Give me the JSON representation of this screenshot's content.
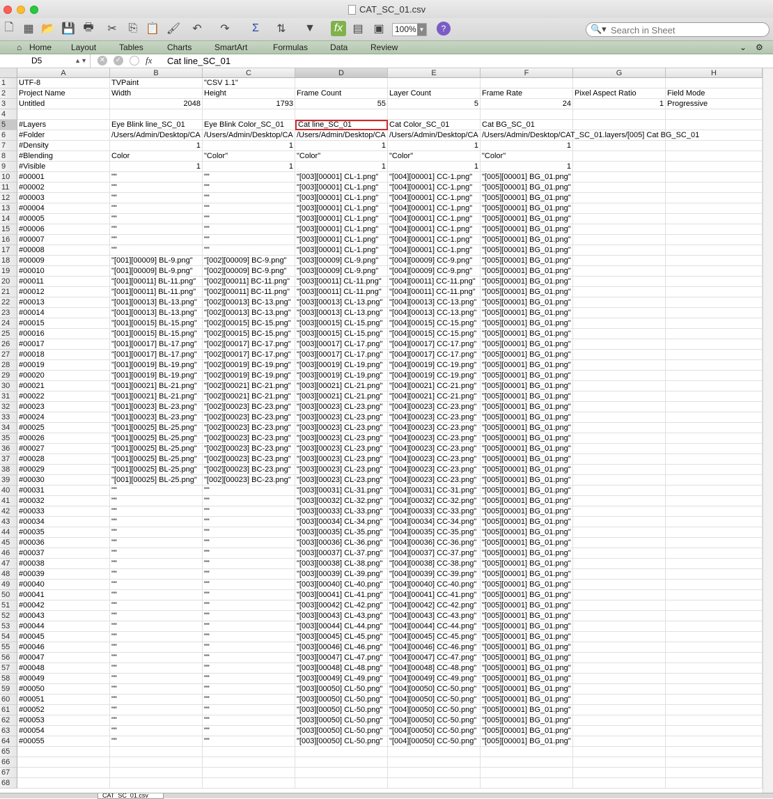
{
  "window": {
    "title": "CAT_SC_01.csv"
  },
  "toolbar": {
    "zoom": "100%",
    "search_placeholder": "Search in Sheet"
  },
  "ribbon": {
    "tabs": [
      "Home",
      "Layout",
      "Tables",
      "Charts",
      "SmartArt",
      "Formulas",
      "Data",
      "Review"
    ]
  },
  "formula_bar": {
    "cell_ref": "D5",
    "fx": "fx",
    "content": "Cat line_SC_01"
  },
  "sheet": {
    "columns": [
      "A",
      "B",
      "C",
      "D",
      "E",
      "F",
      "G",
      "H"
    ],
    "rows": [
      [
        "UTF-8",
        "TVPaint",
        "\"CSV 1.1\"",
        "",
        "",
        "",
        "",
        ""
      ],
      [
        "Project Name",
        "Width",
        "Height",
        "Frame Count",
        "Layer Count",
        "Frame Rate",
        "Pixel Aspect Ratio",
        "Field Mode"
      ],
      [
        "Untitled",
        "2048",
        "1793",
        "55",
        "5",
        "24",
        "1",
        "Progressive"
      ],
      [
        "",
        "",
        "",
        "",
        "",
        "",
        "",
        ""
      ],
      [
        "#Layers",
        "Eye Blink line_SC_01",
        "Eye Blink Color_SC_01",
        "Cat line_SC_01",
        "Cat Color_SC_01",
        "Cat BG_SC_01",
        "",
        ""
      ],
      [
        "#Folder",
        "/Users/Admin/Desktop/CA",
        "/Users/Admin/Desktop/CA",
        "/Users/Admin/Desktop/CA",
        "/Users/Admin/Desktop/CA",
        "/Users/Admin/Desktop/CAT_SC_01.layers/[005] Cat BG_SC_01",
        "",
        ""
      ],
      [
        "#Density",
        "1",
        "1",
        "1",
        "1",
        "1",
        "",
        ""
      ],
      [
        "#Blending",
        "Color",
        "\"Color\"",
        "\"Color\"",
        "\"Color\"",
        "\"Color\"",
        "",
        ""
      ],
      [
        "#Visible",
        "1",
        "1",
        "1",
        "1",
        "1",
        "",
        ""
      ],
      [
        "#00001",
        "\"\"",
        "\"\"",
        "\"[003][00001] CL-1.png\"",
        "\"[004][00001] CC-1.png\"",
        "\"[005][00001] BG_01.png\"",
        "",
        ""
      ],
      [
        "#00002",
        "\"\"",
        "\"\"",
        "\"[003][00001] CL-1.png\"",
        "\"[004][00001] CC-1.png\"",
        "\"[005][00001] BG_01.png\"",
        "",
        ""
      ],
      [
        "#00003",
        "\"\"",
        "\"\"",
        "\"[003][00001] CL-1.png\"",
        "\"[004][00001] CC-1.png\"",
        "\"[005][00001] BG_01.png\"",
        "",
        ""
      ],
      [
        "#00004",
        "\"\"",
        "\"\"",
        "\"[003][00001] CL-1.png\"",
        "\"[004][00001] CC-1.png\"",
        "\"[005][00001] BG_01.png\"",
        "",
        ""
      ],
      [
        "#00005",
        "\"\"",
        "\"\"",
        "\"[003][00001] CL-1.png\"",
        "\"[004][00001] CC-1.png\"",
        "\"[005][00001] BG_01.png\"",
        "",
        ""
      ],
      [
        "#00006",
        "\"\"",
        "\"\"",
        "\"[003][00001] CL-1.png\"",
        "\"[004][00001] CC-1.png\"",
        "\"[005][00001] BG_01.png\"",
        "",
        ""
      ],
      [
        "#00007",
        "\"\"",
        "\"\"",
        "\"[003][00001] CL-1.png\"",
        "\"[004][00001] CC-1.png\"",
        "\"[005][00001] BG_01.png\"",
        "",
        ""
      ],
      [
        "#00008",
        "\"\"",
        "\"\"",
        "\"[003][00001] CL-1.png\"",
        "\"[004][00001] CC-1.png\"",
        "\"[005][00001] BG_01.png\"",
        "",
        ""
      ],
      [
        "#00009",
        "\"[001][00009] BL-9.png\"",
        "\"[002][00009] BC-9.png\"",
        "\"[003][00009] CL-9.png\"",
        "\"[004][00009] CC-9.png\"",
        "\"[005][00001] BG_01.png\"",
        "",
        ""
      ],
      [
        "#00010",
        "\"[001][00009] BL-9.png\"",
        "\"[002][00009] BC-9.png\"",
        "\"[003][00009] CL-9.png\"",
        "\"[004][00009] CC-9.png\"",
        "\"[005][00001] BG_01.png\"",
        "",
        ""
      ],
      [
        "#00011",
        "\"[001][00011] BL-11.png\"",
        "\"[002][00011] BC-11.png\"",
        "\"[003][00011] CL-11.png\"",
        "\"[004][00011] CC-11.png\"",
        "\"[005][00001] BG_01.png\"",
        "",
        ""
      ],
      [
        "#00012",
        "\"[001][00011] BL-11.png\"",
        "\"[002][00011] BC-11.png\"",
        "\"[003][00011] CL-11.png\"",
        "\"[004][00011] CC-11.png\"",
        "\"[005][00001] BG_01.png\"",
        "",
        ""
      ],
      [
        "#00013",
        "\"[001][00013] BL-13.png\"",
        "\"[002][00013] BC-13.png\"",
        "\"[003][00013] CL-13.png\"",
        "\"[004][00013] CC-13.png\"",
        "\"[005][00001] BG_01.png\"",
        "",
        ""
      ],
      [
        "#00014",
        "\"[001][00013] BL-13.png\"",
        "\"[002][00013] BC-13.png\"",
        "\"[003][00013] CL-13.png\"",
        "\"[004][00013] CC-13.png\"",
        "\"[005][00001] BG_01.png\"",
        "",
        ""
      ],
      [
        "#00015",
        "\"[001][00015] BL-15.png\"",
        "\"[002][00015] BC-15.png\"",
        "\"[003][00015] CL-15.png\"",
        "\"[004][00015] CC-15.png\"",
        "\"[005][00001] BG_01.png\"",
        "",
        ""
      ],
      [
        "#00016",
        "\"[001][00015] BL-15.png\"",
        "\"[002][00015] BC-15.png\"",
        "\"[003][00015] CL-15.png\"",
        "\"[004][00015] CC-15.png\"",
        "\"[005][00001] BG_01.png\"",
        "",
        ""
      ],
      [
        "#00017",
        "\"[001][00017] BL-17.png\"",
        "\"[002][00017] BC-17.png\"",
        "\"[003][00017] CL-17.png\"",
        "\"[004][00017] CC-17.png\"",
        "\"[005][00001] BG_01.png\"",
        "",
        ""
      ],
      [
        "#00018",
        "\"[001][00017] BL-17.png\"",
        "\"[002][00017] BC-17.png\"",
        "\"[003][00017] CL-17.png\"",
        "\"[004][00017] CC-17.png\"",
        "\"[005][00001] BG_01.png\"",
        "",
        ""
      ],
      [
        "#00019",
        "\"[001][00019] BL-19.png\"",
        "\"[002][00019] BC-19.png\"",
        "\"[003][00019] CL-19.png\"",
        "\"[004][00019] CC-19.png\"",
        "\"[005][00001] BG_01.png\"",
        "",
        ""
      ],
      [
        "#00020",
        "\"[001][00019] BL-19.png\"",
        "\"[002][00019] BC-19.png\"",
        "\"[003][00019] CL-19.png\"",
        "\"[004][00019] CC-19.png\"",
        "\"[005][00001] BG_01.png\"",
        "",
        ""
      ],
      [
        "#00021",
        "\"[001][00021] BL-21.png\"",
        "\"[002][00021] BC-21.png\"",
        "\"[003][00021] CL-21.png\"",
        "\"[004][00021] CC-21.png\"",
        "\"[005][00001] BG_01.png\"",
        "",
        ""
      ],
      [
        "#00022",
        "\"[001][00021] BL-21.png\"",
        "\"[002][00021] BC-21.png\"",
        "\"[003][00021] CL-21.png\"",
        "\"[004][00021] CC-21.png\"",
        "\"[005][00001] BG_01.png\"",
        "",
        ""
      ],
      [
        "#00023",
        "\"[001][00023] BL-23.png\"",
        "\"[002][00023] BC-23.png\"",
        "\"[003][00023] CL-23.png\"",
        "\"[004][00023] CC-23.png\"",
        "\"[005][00001] BG_01.png\"",
        "",
        ""
      ],
      [
        "#00024",
        "\"[001][00023] BL-23.png\"",
        "\"[002][00023] BC-23.png\"",
        "\"[003][00023] CL-23.png\"",
        "\"[004][00023] CC-23.png\"",
        "\"[005][00001] BG_01.png\"",
        "",
        ""
      ],
      [
        "#00025",
        "\"[001][00025] BL-25.png\"",
        "\"[002][00023] BC-23.png\"",
        "\"[003][00023] CL-23.png\"",
        "\"[004][00023] CC-23.png\"",
        "\"[005][00001] BG_01.png\"",
        "",
        ""
      ],
      [
        "#00026",
        "\"[001][00025] BL-25.png\"",
        "\"[002][00023] BC-23.png\"",
        "\"[003][00023] CL-23.png\"",
        "\"[004][00023] CC-23.png\"",
        "\"[005][00001] BG_01.png\"",
        "",
        ""
      ],
      [
        "#00027",
        "\"[001][00025] BL-25.png\"",
        "\"[002][00023] BC-23.png\"",
        "\"[003][00023] CL-23.png\"",
        "\"[004][00023] CC-23.png\"",
        "\"[005][00001] BG_01.png\"",
        "",
        ""
      ],
      [
        "#00028",
        "\"[001][00025] BL-25.png\"",
        "\"[002][00023] BC-23.png\"",
        "\"[003][00023] CL-23.png\"",
        "\"[004][00023] CC-23.png\"",
        "\"[005][00001] BG_01.png\"",
        "",
        ""
      ],
      [
        "#00029",
        "\"[001][00025] BL-25.png\"",
        "\"[002][00023] BC-23.png\"",
        "\"[003][00023] CL-23.png\"",
        "\"[004][00023] CC-23.png\"",
        "\"[005][00001] BG_01.png\"",
        "",
        ""
      ],
      [
        "#00030",
        "\"[001][00025] BL-25.png\"",
        "\"[002][00023] BC-23.png\"",
        "\"[003][00023] CL-23.png\"",
        "\"[004][00023] CC-23.png\"",
        "\"[005][00001] BG_01.png\"",
        "",
        ""
      ],
      [
        "#00031",
        "\"\"",
        "\"\"",
        "\"[003][00031] CL-31.png\"",
        "\"[004][00031] CC-31.png\"",
        "\"[005][00001] BG_01.png\"",
        "",
        ""
      ],
      [
        "#00032",
        "\"\"",
        "\"\"",
        "\"[003][00032] CL-32.png\"",
        "\"[004][00032] CC-32.png\"",
        "\"[005][00001] BG_01.png\"",
        "",
        ""
      ],
      [
        "#00033",
        "\"\"",
        "\"\"",
        "\"[003][00033] CL-33.png\"",
        "\"[004][00033] CC-33.png\"",
        "\"[005][00001] BG_01.png\"",
        "",
        ""
      ],
      [
        "#00034",
        "\"\"",
        "\"\"",
        "\"[003][00034] CL-34.png\"",
        "\"[004][00034] CC-34.png\"",
        "\"[005][00001] BG_01.png\"",
        "",
        ""
      ],
      [
        "#00035",
        "\"\"",
        "\"\"",
        "\"[003][00035] CL-35.png\"",
        "\"[004][00035] CC-35.png\"",
        "\"[005][00001] BG_01.png\"",
        "",
        ""
      ],
      [
        "#00036",
        "\"\"",
        "\"\"",
        "\"[003][00036] CL-36.png\"",
        "\"[004][00036] CC-36.png\"",
        "\"[005][00001] BG_01.png\"",
        "",
        ""
      ],
      [
        "#00037",
        "\"\"",
        "\"\"",
        "\"[003][00037] CL-37.png\"",
        "\"[004][00037] CC-37.png\"",
        "\"[005][00001] BG_01.png\"",
        "",
        ""
      ],
      [
        "#00038",
        "\"\"",
        "\"\"",
        "\"[003][00038] CL-38.png\"",
        "\"[004][00038] CC-38.png\"",
        "\"[005][00001] BG_01.png\"",
        "",
        ""
      ],
      [
        "#00039",
        "\"\"",
        "\"\"",
        "\"[003][00039] CL-39.png\"",
        "\"[004][00039] CC-39.png\"",
        "\"[005][00001] BG_01.png\"",
        "",
        ""
      ],
      [
        "#00040",
        "\"\"",
        "\"\"",
        "\"[003][00040] CL-40.png\"",
        "\"[004][00040] CC-40.png\"",
        "\"[005][00001] BG_01.png\"",
        "",
        ""
      ],
      [
        "#00041",
        "\"\"",
        "\"\"",
        "\"[003][00041] CL-41.png\"",
        "\"[004][00041] CC-41.png\"",
        "\"[005][00001] BG_01.png\"",
        "",
        ""
      ],
      [
        "#00042",
        "\"\"",
        "\"\"",
        "\"[003][00042] CL-42.png\"",
        "\"[004][00042] CC-42.png\"",
        "\"[005][00001] BG_01.png\"",
        "",
        ""
      ],
      [
        "#00043",
        "\"\"",
        "\"\"",
        "\"[003][00043] CL-43.png\"",
        "\"[004][00043] CC-43.png\"",
        "\"[005][00001] BG_01.png\"",
        "",
        ""
      ],
      [
        "#00044",
        "\"\"",
        "\"\"",
        "\"[003][00044] CL-44.png\"",
        "\"[004][00044] CC-44.png\"",
        "\"[005][00001] BG_01.png\"",
        "",
        ""
      ],
      [
        "#00045",
        "\"\"",
        "\"\"",
        "\"[003][00045] CL-45.png\"",
        "\"[004][00045] CC-45.png\"",
        "\"[005][00001] BG_01.png\"",
        "",
        ""
      ],
      [
        "#00046",
        "\"\"",
        "\"\"",
        "\"[003][00046] CL-46.png\"",
        "\"[004][00046] CC-46.png\"",
        "\"[005][00001] BG_01.png\"",
        "",
        ""
      ],
      [
        "#00047",
        "\"\"",
        "\"\"",
        "\"[003][00047] CL-47.png\"",
        "\"[004][00047] CC-47.png\"",
        "\"[005][00001] BG_01.png\"",
        "",
        ""
      ],
      [
        "#00048",
        "\"\"",
        "\"\"",
        "\"[003][00048] CL-48.png\"",
        "\"[004][00048] CC-48.png\"",
        "\"[005][00001] BG_01.png\"",
        "",
        ""
      ],
      [
        "#00049",
        "\"\"",
        "\"\"",
        "\"[003][00049] CL-49.png\"",
        "\"[004][00049] CC-49.png\"",
        "\"[005][00001] BG_01.png\"",
        "",
        ""
      ],
      [
        "#00050",
        "\"\"",
        "\"\"",
        "\"[003][00050] CL-50.png\"",
        "\"[004][00050] CC-50.png\"",
        "\"[005][00001] BG_01.png\"",
        "",
        ""
      ],
      [
        "#00051",
        "\"\"",
        "\"\"",
        "\"[003][00050] CL-50.png\"",
        "\"[004][00050] CC-50.png\"",
        "\"[005][00001] BG_01.png\"",
        "",
        ""
      ],
      [
        "#00052",
        "\"\"",
        "\"\"",
        "\"[003][00050] CL-50.png\"",
        "\"[004][00050] CC-50.png\"",
        "\"[005][00001] BG_01.png\"",
        "",
        ""
      ],
      [
        "#00053",
        "\"\"",
        "\"\"",
        "\"[003][00050] CL-50.png\"",
        "\"[004][00050] CC-50.png\"",
        "\"[005][00001] BG_01.png\"",
        "",
        ""
      ],
      [
        "#00054",
        "\"\"",
        "\"\"",
        "\"[003][00050] CL-50.png\"",
        "\"[004][00050] CC-50.png\"",
        "\"[005][00001] BG_01.png\"",
        "",
        ""
      ],
      [
        "#00055",
        "\"\"",
        "\"\"",
        "\"[003][00050] CL-50.png\"",
        "\"[004][00050] CC-50.png\"",
        "\"[005][00001] BG_01.png\"",
        "",
        ""
      ],
      [
        "",
        "",
        "",
        "",
        "",
        "",
        "",
        ""
      ],
      [
        "",
        "",
        "",
        "",
        "",
        "",
        "",
        ""
      ],
      [
        "",
        "",
        "",
        "",
        "",
        "",
        "",
        ""
      ],
      [
        "",
        "",
        "",
        "",
        "",
        "",
        "",
        ""
      ]
    ],
    "active_cell": {
      "row": 5,
      "col": "D"
    },
    "tab_name": "CAT_SC_01.csv"
  },
  "colors": {
    "active_cell_border": "#d0282c",
    "ribbon_bg": "#b3c6ae"
  },
  "icons": [
    "new-doc-icon",
    "templates-icon",
    "open-icon",
    "save-icon",
    "print-icon",
    "cut-icon",
    "copy-icon",
    "paste-icon",
    "format-icon",
    "undo-icon",
    "redo-icon",
    "sum-icon",
    "sort-icon",
    "filter-icon",
    "fx-icon",
    "gallery-icon",
    "toolbox-icon",
    "help-icon",
    "search-icon",
    "gear-icon",
    "chevron-down-icon"
  ]
}
